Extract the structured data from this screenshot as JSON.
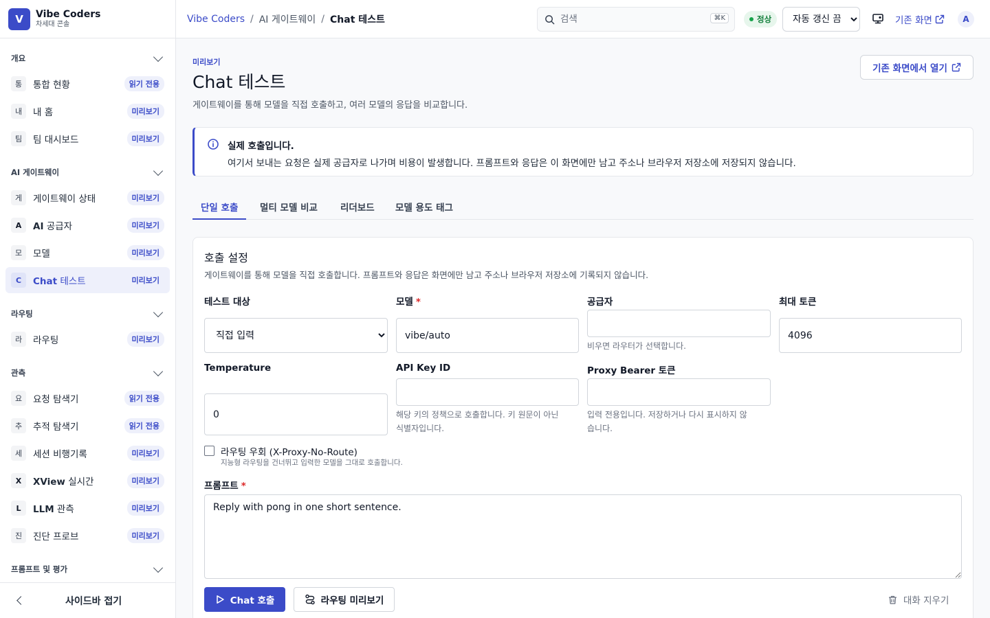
{
  "brand": {
    "logo_letter": "V",
    "name": "Vibe Coders",
    "subtitle": "차세대 콘솔"
  },
  "sidebar": {
    "sections": {
      "overview": "개요",
      "gateway": "AI 게이트웨이",
      "routing": "라우팅",
      "observability": "관측",
      "prompts": "프롬프트 및 평가"
    },
    "items": [
      {
        "letter": "통",
        "label": "통합 현황",
        "badge": "읽기 전용"
      },
      {
        "letter": "내",
        "label": "내 홈",
        "badge": "미리보기"
      },
      {
        "letter": "팀",
        "label": "팀 대시보드",
        "badge": "미리보기"
      },
      {
        "letter": "게",
        "label": "게이트웨이 상태",
        "badge": "미리보기"
      },
      {
        "letter": "A",
        "label_bold": "AI",
        "label": " 공급자",
        "badge": "미리보기"
      },
      {
        "letter": "모",
        "label": "모델",
        "badge": "미리보기"
      },
      {
        "letter": "C",
        "label_bold": "Chat",
        "label": " 테스트",
        "badge": "미리보기"
      },
      {
        "letter": "라",
        "label": "라우팅",
        "badge": "미리보기"
      },
      {
        "letter": "요",
        "label": "요청 탐색기",
        "badge": "읽기 전용"
      },
      {
        "letter": "추",
        "label": "추적 탐색기",
        "badge": "읽기 전용"
      },
      {
        "letter": "세",
        "label": "세션 비행기록",
        "badge": "미리보기"
      },
      {
        "letter": "X",
        "label_bold": "XView",
        "label": " 실시간",
        "badge": "미리보기"
      },
      {
        "letter": "L",
        "label_bold": "LLM",
        "label": " 관측",
        "badge": "미리보기"
      },
      {
        "letter": "진",
        "label": "진단 프로브",
        "badge": "미리보기"
      }
    ],
    "collapse_label": "사이드바 접기"
  },
  "topbar": {
    "breadcrumb": [
      "Vibe Coders",
      "AI 게이트웨이",
      "Chat 테스트"
    ],
    "search_placeholder": "검색",
    "search_shortcut": "⌘K",
    "status": "정상",
    "refresh_option": "자동 갱신 끔",
    "legacy_link": "기존 화면",
    "avatar_letter": "A"
  },
  "page": {
    "eyebrow": "미리보기",
    "title": "Chat 테스트",
    "description": "게이트웨이를 통해 모델을 직접 호출하고, 여러 모델의 응답을 비교합니다.",
    "open_legacy_button": "기존 화면에서 열기"
  },
  "alert": {
    "title": "실제 호출입니다.",
    "body": "여기서 보내는 요청은 실제 공급자로 나가며 비용이 발생합니다. 프롬프트와 응답은 이 화면에만 남고 주소나 브라우저 저장소에 저장되지 않습니다."
  },
  "tabs": [
    "단일 호출",
    "멀티 모델 비교",
    "리더보드",
    "모델 용도 태그"
  ],
  "form": {
    "title": "호출 설정",
    "description": "게이트웨이를 통해 모델을 직접 호출합니다. 프롬프트와 응답은 화면에만 남고 주소나 브라우저 저장소에 기록되지 않습니다.",
    "target_label": "테스트 대상",
    "target_value": "직접 입력",
    "model_label": "모델",
    "model_value": "vibe/auto",
    "provider_label": "공급자",
    "provider_value": "",
    "provider_hint": "비우면 라우터가 선택합니다.",
    "max_tokens_label": "최대 토큰",
    "max_tokens_value": "4096",
    "temperature_label": "Temperature",
    "temperature_value": "0",
    "api_key_label": "API Key ID",
    "api_key_value": "",
    "api_key_hint_1": "해당 키의 정책으로 호출합니다. 키 원문이 아닌",
    "api_key_hint_2": "식별자입니다.",
    "proxy_label": "Proxy Bearer 토큰",
    "proxy_value": "",
    "proxy_hint_1": "입력 전용입니다. 저장하거나 다시 표시하지 않",
    "proxy_hint_2": "습니다.",
    "bypass_label": "라우팅 우회 (X-Proxy-No-Route)",
    "bypass_hint": "지능형 라우팅을 건너뛰고 입력한 모델을 그대로 호출합니다.",
    "prompt_label": "프롬프트",
    "prompt_value": "Reply with pong in one short sentence.",
    "required_mark": "*",
    "call_button": "Chat 호출",
    "preview_button": "라우팅 미리보기",
    "clear_button": "대화 지우기"
  },
  "colors": {
    "accent": "#3b4bc8",
    "success": "#16a34a",
    "required": "#dc2626"
  }
}
